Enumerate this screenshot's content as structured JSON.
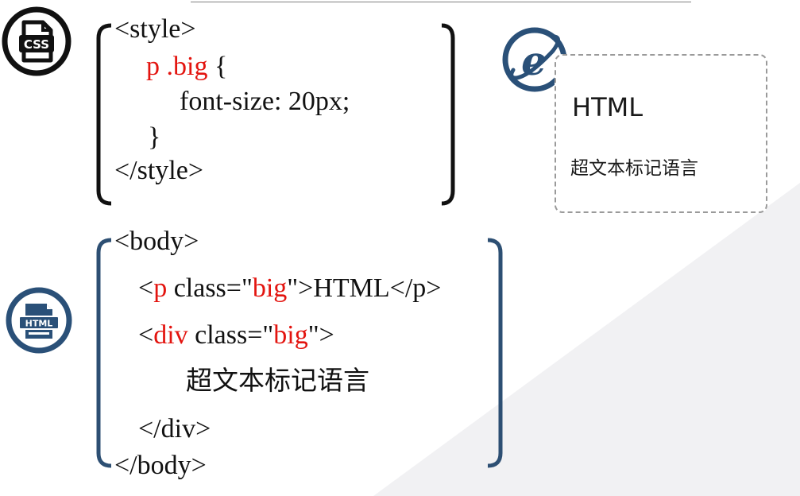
{
  "css_code": {
    "open_tag": "<style>",
    "selector": "p .big",
    "brace_open": " {",
    "declaration": "font-size: 20px;",
    "brace_close": "}",
    "close_tag": "</style>"
  },
  "html_code": {
    "body_open": "<body>",
    "p_lt": "<",
    "p_tag": "p",
    "p_attr": " class=\"",
    "p_value": "big",
    "p_rest": "\">HTML</p>",
    "div_lt": "<",
    "div_tag": "div",
    "div_attr": " class=\"",
    "div_value": "big",
    "div_rest": "\">",
    "div_text": "超文本标记语言",
    "div_close": "</div>",
    "body_close": "</body>"
  },
  "preview": {
    "heading": "HTML",
    "text": "超文本标记语言"
  },
  "icons": {
    "css": "css-file-icon",
    "browser": "ie-browser-icon",
    "html": "html-file-icon"
  },
  "colors": {
    "highlight": "#e3140f",
    "html_bracket": "#2d4f73",
    "css_bracket": "#111111",
    "icon_blue": "#2a5078"
  }
}
